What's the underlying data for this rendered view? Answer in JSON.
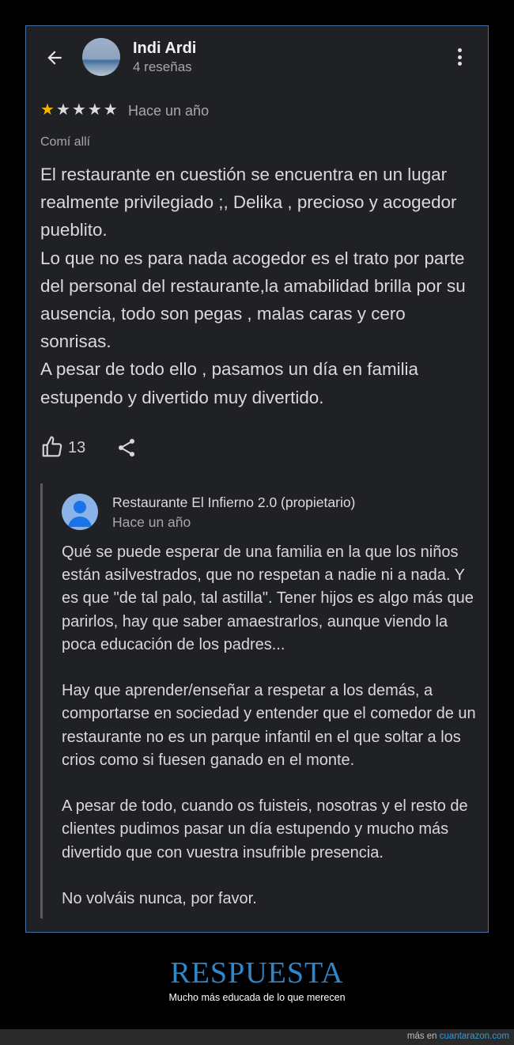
{
  "header": {
    "user_name": "Indi Ardi",
    "user_meta": "4 reseñas"
  },
  "review": {
    "rating": 1,
    "rating_max": 5,
    "date": "Hace un año",
    "visit_note": "Comí allí",
    "paragraphs": [
      "El restaurante en cuestión se encuentra en un lugar realmente privilegiado ;, Delika , precioso y acogedor pueblito.",
      "Lo que no es para nada acogedor es el trato por parte del personal del restaurante,la amabilidad brilla por su ausencia, todo son pegas , malas caras y cero sonrisas.",
      "A pesar de todo ello , pasamos un día en familia estupendo y divertido muy divertido."
    ],
    "likes": "13"
  },
  "owner_reply": {
    "name": "Restaurante El Infierno 2.0 (propietario)",
    "date": "Hace un año",
    "paragraphs": [
      "Qué se puede esperar de una familia en la que los niños están asilvestrados, que no respetan a nadie ni a nada. Y es que \"de tal palo, tal astilla\". Tener hijos es algo más que parirlos, hay que saber amaestrarlos, aunque viendo la poca educación de los padres...",
      "Hay que aprender/enseñar a respetar a los demás, a comportarse en sociedad y entender que el comedor de un restaurante no es un parque infantil en el que soltar a los crios como si fuesen ganado en el monte.",
      "A pesar de todo, cuando os fuisteis, nosotras y el resto de clientes pudimos pasar un día estupendo y mucho más divertido que con vuestra insufrible presencia.",
      "No volváis nunca, por favor."
    ]
  },
  "caption": {
    "headline": "RESPUESTA",
    "subline": "Mucho más educada de lo que merecen"
  },
  "footer": {
    "prefix": "más en",
    "site": "cuantarazon.com"
  },
  "colors": {
    "card_bg": "#202124",
    "frame_border": "#4a6fa3",
    "star_on": "#f6b400",
    "headline": "#2f86c9",
    "link": "#2f9be3"
  },
  "icons": [
    "back-arrow-icon",
    "more-vert-icon",
    "star-icon",
    "thumb-up-icon",
    "share-icon",
    "person-icon"
  ]
}
